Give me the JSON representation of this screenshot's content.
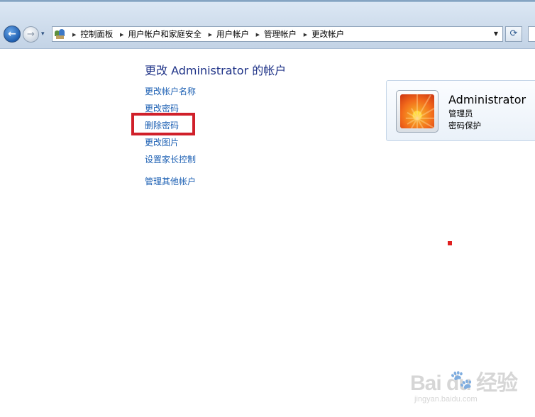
{
  "nav": {
    "back_glyph": "←",
    "forward_glyph": "→",
    "history_glyph": "▾",
    "refresh_glyph": "⟳",
    "address_dropdown_glyph": "▼",
    "breadcrumb": [
      "控制面板",
      "用户帐户和家庭安全",
      "用户帐户",
      "管理帐户",
      "更改帐户"
    ]
  },
  "main": {
    "title": "更改 Administrator 的帐户",
    "tasks": [
      "更改帐户名称",
      "更改密码",
      "删除密码",
      "更改图片",
      "设置家长控制"
    ],
    "other_link": "管理其他帐户"
  },
  "account": {
    "name": "Administrator",
    "role": "管理员",
    "status": "密码保护",
    "avatar_icon": "orange-flower-avatar-icon"
  },
  "annotation": {
    "highlight_color": "#d0202a"
  },
  "watermark": {
    "main": "Bai  du 经验",
    "sub": "jingyan.baidu.com"
  }
}
